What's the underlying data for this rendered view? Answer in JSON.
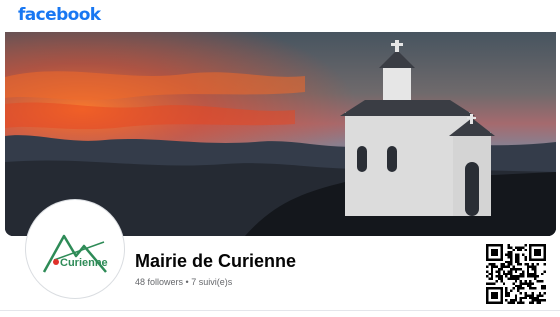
{
  "app": {
    "logo_text": "facebook"
  },
  "profile": {
    "name": "Mairie de Curienne",
    "followers": "48 followers",
    "separator": " • ",
    "following": "7 suivi(e)s",
    "avatar_text": "Curienne"
  },
  "colors": {
    "brand": "#1877f2",
    "name_text": "#050505",
    "meta_text": "#65676b",
    "avatar_logo_green": "#2e8b57",
    "avatar_logo_red": "#e0302a"
  },
  "icons": {
    "qr": "qr-code-icon"
  }
}
